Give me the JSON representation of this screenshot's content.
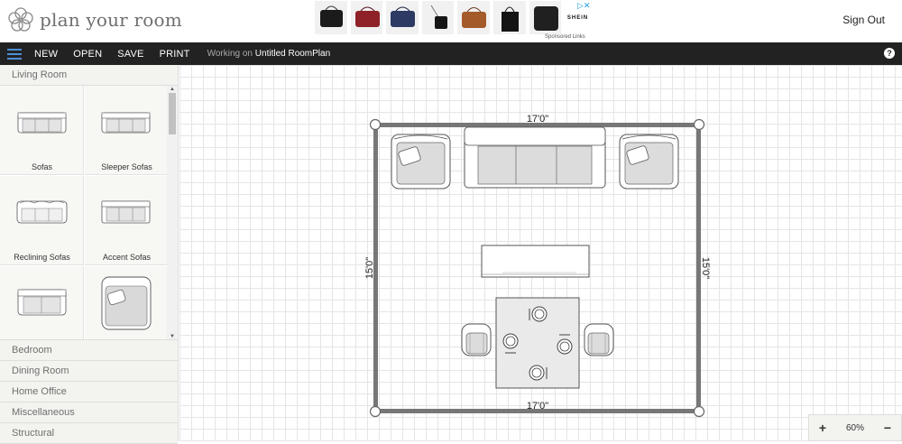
{
  "header": {
    "logo_text": "plan your room",
    "ad_brand": "SHEIN",
    "ad_sponsored": "Sponsored Links",
    "sign_out": "Sign Out"
  },
  "toolbar": {
    "new": "NEW",
    "open": "OPEN",
    "save": "SAVE",
    "print": "PRINT",
    "working_prefix": "Working on",
    "document_name": "Untitled RoomPlan",
    "help": "?"
  },
  "sidebar": {
    "active_category": "Living Room",
    "tiles": [
      {
        "label": "Sofas",
        "icon": "sofa-icon"
      },
      {
        "label": "Sleeper Sofas",
        "icon": "sleeper-sofa-icon"
      },
      {
        "label": "Reclining Sofas",
        "icon": "reclining-sofa-icon"
      },
      {
        "label": "Accent Sofas",
        "icon": "accent-sofa-icon"
      },
      {
        "label": "",
        "icon": "loveseat-icon"
      },
      {
        "label": "",
        "icon": "armchair-icon"
      }
    ],
    "categories": [
      "Bedroom",
      "Dining Room",
      "Home Office",
      "Miscellaneous",
      "Structural"
    ]
  },
  "room": {
    "top_dimension": "17'0\"",
    "bottom_dimension": "17'0\"",
    "left_dimension": "15'0\"",
    "right_dimension": "15'0\""
  },
  "zoom": {
    "minus": "−",
    "plus": "+",
    "level": "60%"
  },
  "colors": {
    "toolbar_bg": "#222222",
    "menu_accent": "#4d8fd8",
    "wall": "#777777",
    "furniture_fill": "#dcdcdc"
  }
}
